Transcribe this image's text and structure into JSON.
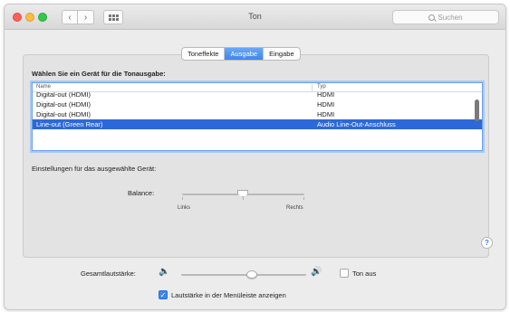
{
  "window": {
    "title": "Ton"
  },
  "search": {
    "placeholder": "Suchen"
  },
  "tabs": [
    {
      "label": "Toneffekte",
      "active": false
    },
    {
      "label": "Ausgabe",
      "active": true
    },
    {
      "label": "Eingabe",
      "active": false
    }
  ],
  "output": {
    "heading": "Wählen Sie ein Gerät für die Tonausgabe:",
    "columns": {
      "name": "Name",
      "type": "Typ"
    },
    "rows": [
      {
        "name": "Digital-out (HDMI)",
        "type": "HDMI",
        "selected": false
      },
      {
        "name": "Digital-out (HDMI)",
        "type": "HDMI",
        "selected": false
      },
      {
        "name": "Digital-out (HDMI)",
        "type": "HDMI",
        "selected": false
      },
      {
        "name": "Line-out (Green Rear)",
        "type": "Audio Line-Out-Anschluss",
        "selected": true
      }
    ]
  },
  "settings": {
    "heading": "Einstellungen für das ausgewählte Gerät:",
    "balance_label": "Balance:",
    "balance_left": "Links",
    "balance_right": "Rechts",
    "balance_value": 0.5
  },
  "volume": {
    "label": "Gesamtlautstärke:",
    "level": 0.5,
    "mute_label": "Ton aus",
    "muted": false
  },
  "menubar": {
    "label": "Lautstärke in der Menüleiste anzeigen",
    "checked": true
  },
  "help": {
    "glyph": "?"
  },
  "colors": {
    "accent": "#3d86ef",
    "selection": "#2c68d8"
  }
}
